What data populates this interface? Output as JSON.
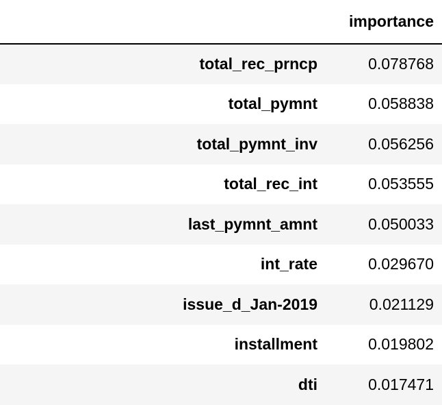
{
  "table": {
    "columns": [
      "importance"
    ],
    "rows": [
      {
        "label": "total_rec_prncp",
        "value": "0.078768"
      },
      {
        "label": "total_pymnt",
        "value": "0.058838"
      },
      {
        "label": "total_pymnt_inv",
        "value": "0.056256"
      },
      {
        "label": "total_rec_int",
        "value": "0.053555"
      },
      {
        "label": "last_pymnt_amnt",
        "value": "0.050033"
      },
      {
        "label": "int_rate",
        "value": "0.029670"
      },
      {
        "label": "issue_d_Jan-2019",
        "value": "0.021129"
      },
      {
        "label": "installment",
        "value": "0.019802"
      },
      {
        "label": "dti",
        "value": "0.017471"
      }
    ]
  },
  "colors": {
    "row_stripe": "#f5f5f5",
    "row_plain": "#ffffff",
    "header_rule": "#000000",
    "text": "#000000"
  }
}
